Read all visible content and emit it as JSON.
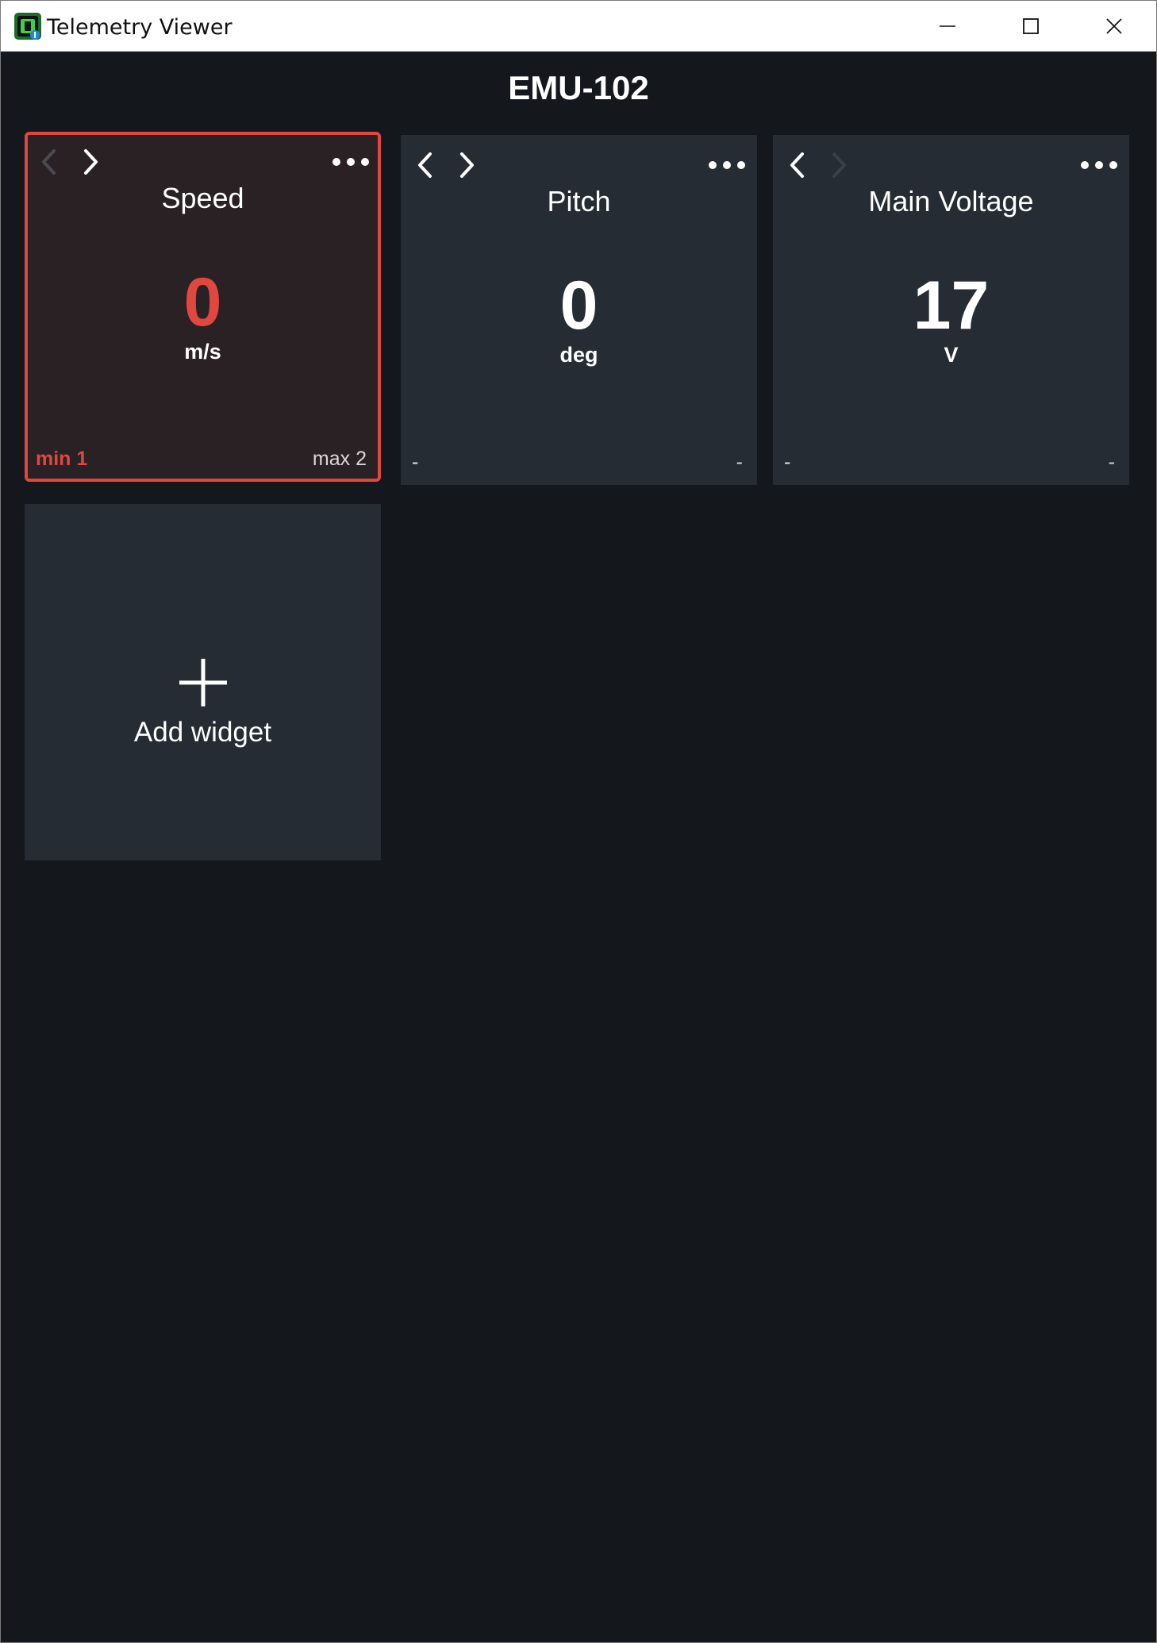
{
  "window": {
    "title": "Telemetry Viewer",
    "icon": "telemetry-app-icon",
    "controls": [
      "minimize-icon",
      "maximize-icon",
      "close-icon"
    ]
  },
  "page": {
    "title": "EMU-102"
  },
  "widgets": [
    {
      "title": "Speed",
      "value": "0",
      "unit": "m/s",
      "min": "min 1",
      "max": "max 2",
      "alert": true,
      "prev_enabled": false,
      "next_enabled": true
    },
    {
      "title": "Pitch",
      "value": "0",
      "unit": "deg",
      "min": "-",
      "max": "-",
      "alert": false,
      "prev_enabled": true,
      "next_enabled": true
    },
    {
      "title": "Main Voltage",
      "value": "17",
      "unit": "V",
      "min": "-",
      "max": "-",
      "alert": false,
      "prev_enabled": true,
      "next_enabled": false
    }
  ],
  "add_widget": {
    "label": "Add widget",
    "icon": "plus-icon"
  },
  "colors": {
    "background": "#14171c",
    "tile": "#262c33",
    "alert_tile": "#2a2125",
    "alert": "#e0483f",
    "text": "#ffffff"
  }
}
